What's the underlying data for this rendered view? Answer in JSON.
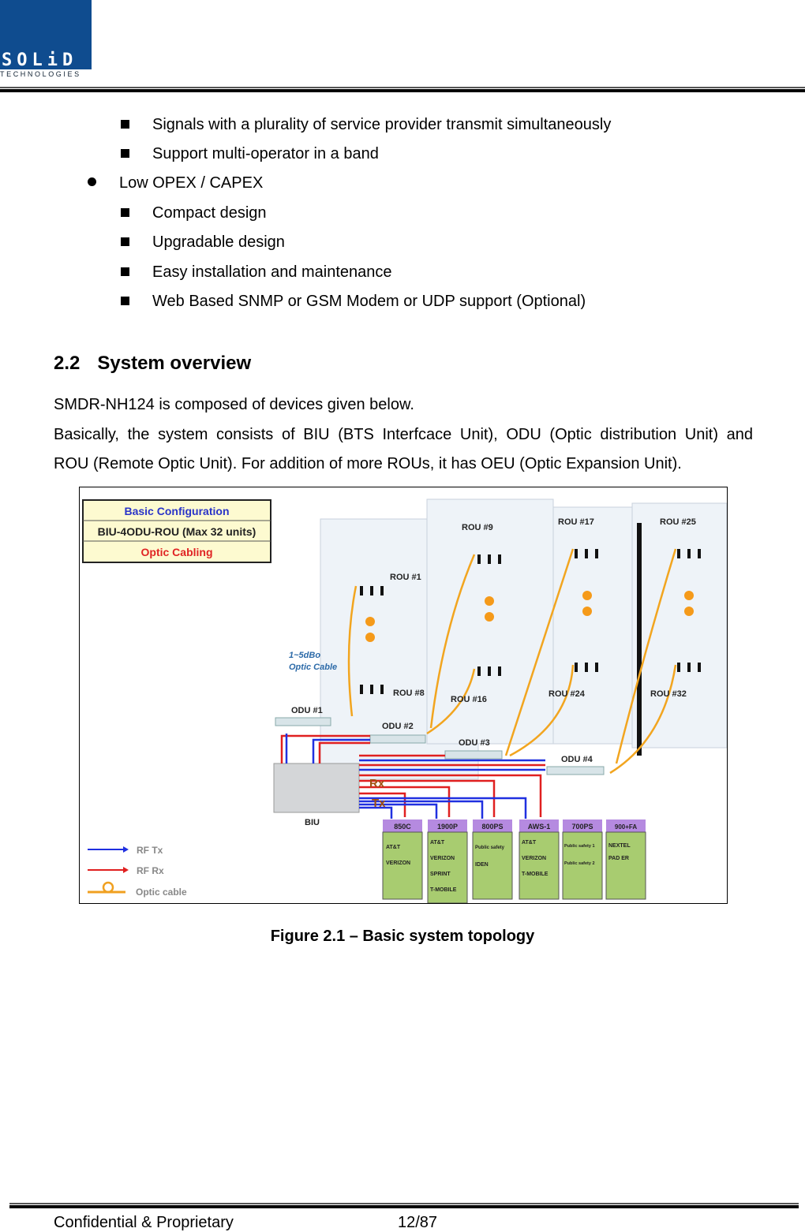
{
  "header": {
    "logo_text": "SOLiD",
    "logo_subtext": "TECHNOLOGIES"
  },
  "bullets": [
    {
      "level": 2,
      "text": "Signals with a plurality of service provider transmit simultaneously"
    },
    {
      "level": 2,
      "text": "Support multi-operator in a band"
    },
    {
      "level": 1,
      "text": "Low OPEX / CAPEX"
    },
    {
      "level": 2,
      "text": "Compact design"
    },
    {
      "level": 2,
      "text": "Upgradable design"
    },
    {
      "level": 2,
      "text": "Easy installation and maintenance"
    },
    {
      "level": 2,
      "text": "Web Based SNMP or GSM Modem or UDP support (Optional)"
    }
  ],
  "section": {
    "number": "2.2",
    "title": "System overview"
  },
  "paragraphs": [
    "SMDR-NH124 is composed of devices given below.",
    "Basically, the system consists of BIU (BTS Interfcace Unit), ODU (Optic distribution Unit) and",
    "ROU (Remote Optic Unit). For addition of more ROUs, it has OEU (Optic Expansion Unit)."
  ],
  "figure": {
    "config_box": {
      "title": "Basic Configuration",
      "row": "BIU-4ODU-ROU (Max 32 units)",
      "cabling": "Optic Cabling"
    },
    "rou_labels": [
      "ROU #9",
      "ROU #17",
      "ROU #25",
      "ROU #1",
      "ROU #8",
      "ROU #16",
      "ROU #24",
      "ROU #32"
    ],
    "odu_labels": [
      "ODU #1",
      "ODU #2",
      "ODU #3",
      "ODU #4"
    ],
    "biu_label": "BIU",
    "rx_label": "Rx",
    "tx_label": "Tx",
    "cable_note": [
      "1~5dBo",
      "Optic Cable"
    ],
    "bands": [
      {
        "name": "850C",
        "carriers": [
          "AT&T",
          "VERIZON"
        ]
      },
      {
        "name": "1900P",
        "carriers": [
          "AT&T",
          "VERIZON",
          "SPRINT",
          "T-MOBILE"
        ]
      },
      {
        "name": "800PS",
        "carriers": [
          "Public safety",
          "IDEN"
        ]
      },
      {
        "name": "AWS-1",
        "carriers": [
          "AT&T",
          "VERIZON",
          "T-MOBILE"
        ]
      },
      {
        "name": "700PS",
        "carriers": [
          "Public safety 1",
          "Public safety 2"
        ]
      },
      {
        "name": "900+FA",
        "carriers": [
          "NEXTEL",
          "PAD ER"
        ]
      }
    ],
    "legend": [
      {
        "label": "RF Tx",
        "color": "#1f2fe0"
      },
      {
        "label": "RF Rx",
        "color": "#e01f1f"
      },
      {
        "label": "Optic cable",
        "color": "#f0a020"
      }
    ],
    "caption": "Figure 2.1 – Basic system topology"
  },
  "footer": {
    "left": "Confidential & Proprietary",
    "page": "12/87"
  }
}
